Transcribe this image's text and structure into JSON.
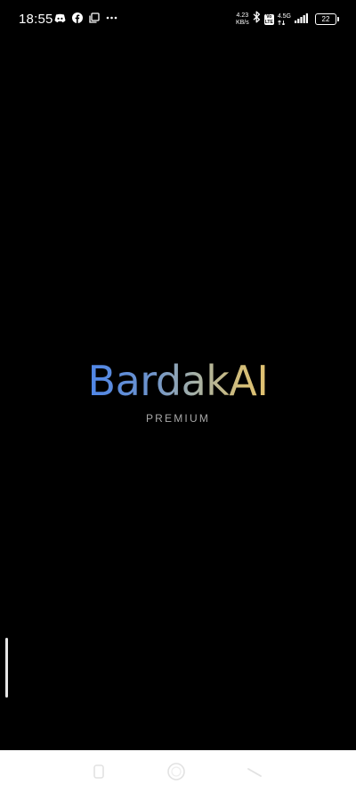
{
  "status_bar": {
    "time": "18:55",
    "left_icons": [
      "discord-icon",
      "facebook-icon",
      "copy-icon",
      "more-dots-icon"
    ],
    "net_speed_value": "4.23",
    "net_speed_unit": "KB/s",
    "volte_top": "Vo",
    "volte_bottom": "LTE",
    "network_type": "4.5G",
    "battery_level": "22"
  },
  "splash": {
    "title": "BardakAI",
    "subtitle": "PREMIUM",
    "gradient_colors": [
      "#4f86e8",
      "#a7b1a6",
      "#e2c271"
    ]
  },
  "nav_bar": {
    "buttons": [
      "recents-icon",
      "home-icon",
      "back-icon"
    ]
  }
}
